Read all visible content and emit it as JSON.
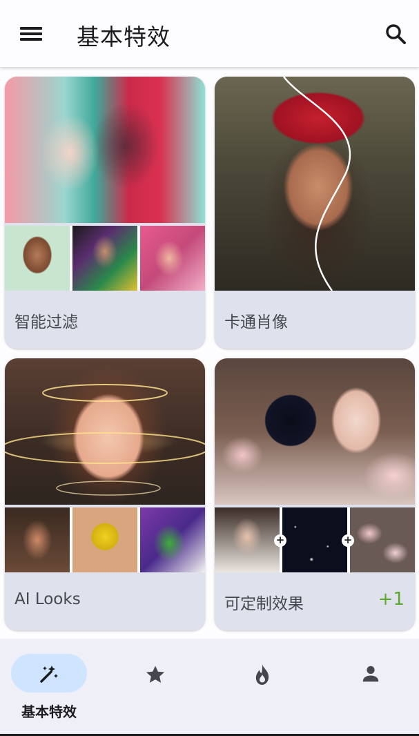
{
  "header": {
    "title": "基本特效",
    "menu_icon": "menu-icon",
    "search_icon": "search-icon"
  },
  "cards": [
    {
      "label": "智能过滤",
      "badge": ""
    },
    {
      "label": "卡通肖像",
      "badge": ""
    },
    {
      "label": "AI Looks",
      "badge": ""
    },
    {
      "label": "可定制效果",
      "badge": "+1"
    }
  ],
  "bottom_nav": {
    "items": [
      {
        "label": "基本特效",
        "icon": "magic-wand-icon",
        "selected": true
      },
      {
        "label": "",
        "icon": "star-icon",
        "selected": false
      },
      {
        "label": "",
        "icon": "fire-icon",
        "selected": false
      },
      {
        "label": "",
        "icon": "person-icon",
        "selected": false
      }
    ]
  },
  "colors": {
    "nav_selected_pill": "#cfe5ff",
    "badge_green": "#5aa82c",
    "card_background": "#dfe2ec"
  }
}
